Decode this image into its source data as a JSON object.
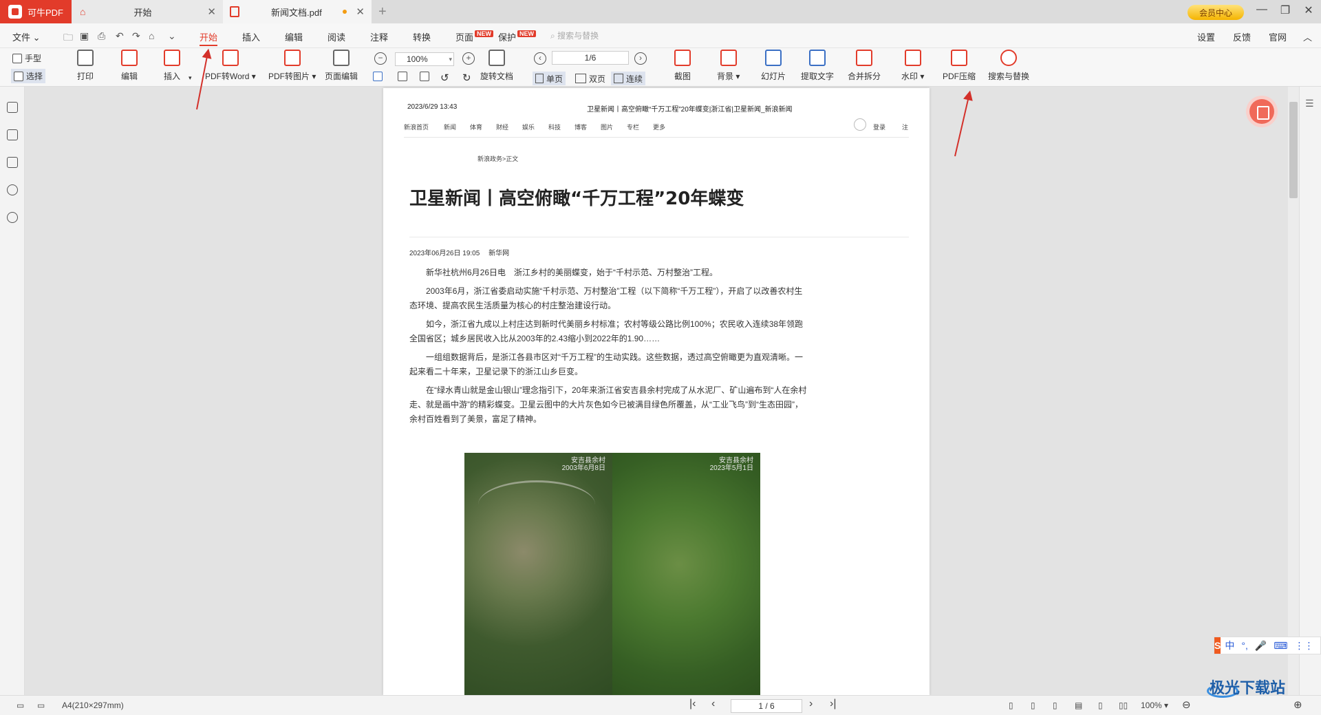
{
  "titlebar": {
    "app_name": "可牛PDF",
    "home_tab": "开始",
    "doc_tab": "新闻文档.pdf",
    "vip_label": "会员中心",
    "icons": [
      "home-icon",
      "pdf-file-icon",
      "close-icon",
      "plus-icon",
      "minimize-icon",
      "restore-icon",
      "close-window-icon"
    ]
  },
  "menubar": {
    "file": "文件",
    "tabs": [
      "开始",
      "插入",
      "编辑",
      "阅读",
      "注释",
      "转换",
      "页面",
      "保护"
    ],
    "new_badge": "NEW",
    "search_placeholder": "搜索与替换",
    "right": [
      "设置",
      "反馈",
      "官网"
    ]
  },
  "ribbon": {
    "hand": "手型",
    "select": "选择",
    "print": "打印",
    "edit": "编辑",
    "insert": "插入",
    "pdf_to_word": "PDF转Word",
    "pdf_to_image": "PDF转图片",
    "page_edit": "页面编辑",
    "zoom": "100%",
    "rotate_doc": "旋转文档",
    "page_value": "1/6",
    "single": "单页",
    "double": "双页",
    "continuous": "连续",
    "screenshot": "截图",
    "background": "背景",
    "slideshow": "幻灯片",
    "extract_text": "提取文字",
    "merge_split": "合并拆分",
    "watermark": "水印",
    "pdf_compress": "PDF压缩",
    "search_replace": "搜索与替换"
  },
  "document": {
    "print_date": "2023/6/29 13:43",
    "header_title": "卫星新闻丨高空俯瞰“千万工程”20年蝶变|浙江省|卫星新闻_新浪新闻",
    "nav": [
      "新浪首页",
      "新闻",
      "体育",
      "财经",
      "娱乐",
      "科技",
      "博客",
      "图片",
      "专栏",
      "更多",
      "登录",
      "注"
    ],
    "breadcrumb": "新浪政务>正文",
    "title": "卫星新闻丨高空俯瞰“千万工程”20年蝶变",
    "pub_date": "2023年06月26日 19:05",
    "source": "新华网",
    "paragraphs": [
      "新华社杭州6月26日电　浙江乡村的美丽蝶变，始于“千村示范、万村整治”工程。",
      "2003年6月，浙江省委启动实施“千村示范、万村整治”工程（以下简称“千万工程”），开启了以改善农村生态环境、提高农民生活质量为核心的村庄整治建设行动。",
      "如今，浙江省九成以上村庄达到新时代美丽乡村标准；农村等级公路比例100%；农民收入连续38年领跑全国省区；城乡居民收入比从2003年的2.43缩小到2022年的1.90……",
      "一组组数据背后，是浙江各县市区对“千万工程”的生动实践。这些数据，透过高空俯瞰更为直观清晰。一起来看二十年来，卫星记录下的浙江山乡巨变。",
      "在“绿水青山就是金山银山”理念指引下，20年来浙江省安吉县余村完成了从水泥厂、矿山遍布到“人在余村走、就是画中游”的精彩蝶变。卫星云图中的大片灰色如今已被满目绿色所覆盖，从“工业飞鸟”到“生态田园”，余村百姓看到了美景，富足了精神。"
    ],
    "image_left_label": "安吉县余村\n2003年6月8日",
    "image_right_label": "安吉县余村\n2023年5月1日"
  },
  "statusbar": {
    "paper_size": "A4(210×297mm)",
    "page": "1 / 6",
    "zoom": "100%"
  },
  "ime": {
    "logo": "S",
    "items": [
      "中",
      "°,",
      "🎤",
      "⌨",
      "⋮⋮"
    ]
  },
  "watermark_site": "极光下载站"
}
